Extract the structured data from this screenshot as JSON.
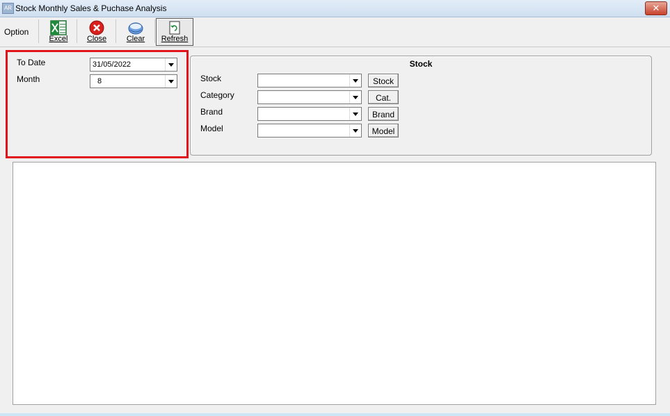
{
  "window": {
    "title": "Stock Monthly Sales & Puchase Analysis",
    "app_icon": "AR",
    "close_glyph": "✕"
  },
  "toolbar": {
    "option_label": "Option",
    "buttons": [
      {
        "label": "Excel",
        "icon": "excel-icon"
      },
      {
        "label": "Close",
        "icon": "close-red-icon"
      },
      {
        "label": "Clear",
        "icon": "clear-icon"
      },
      {
        "label": "Refresh",
        "icon": "refresh-icon"
      }
    ]
  },
  "filters": {
    "to_date_label": "To Date",
    "to_date_value": "31/05/2022",
    "month_label": "Month",
    "month_value": "8"
  },
  "stock_group": {
    "title": "Stock",
    "rows": [
      {
        "label": "Stock",
        "value": "",
        "button": "Stock"
      },
      {
        "label": "Category",
        "value": "",
        "button": "Cat."
      },
      {
        "label": "Brand",
        "value": "",
        "button": "Brand"
      },
      {
        "label": "Model",
        "value": "",
        "button": "Model"
      }
    ]
  },
  "colors": {
    "highlight": "#e1141b"
  }
}
